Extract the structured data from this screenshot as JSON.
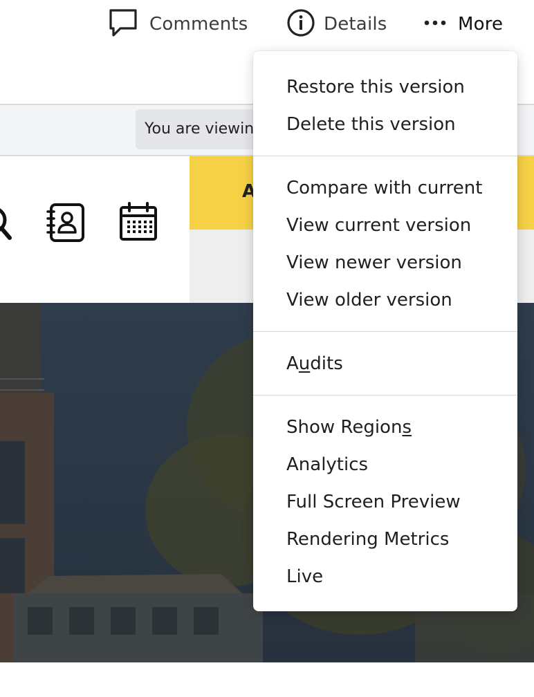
{
  "toolbar": {
    "comments_label": "Comments",
    "details_label": "Details",
    "more_label": "More"
  },
  "version_bar": {
    "notice_text": "You are viewing"
  },
  "preview": {
    "yellow_panel_text": "A",
    "icons": [
      "search-icon",
      "contact-book-icon",
      "calendar-icon"
    ]
  },
  "menu": {
    "groups": [
      {
        "items": [
          {
            "label": "Restore this version"
          },
          {
            "label": "Delete this version"
          }
        ]
      },
      {
        "items": [
          {
            "label": "Compare with current"
          },
          {
            "label": "View current version"
          },
          {
            "label": "View newer version"
          },
          {
            "label": "View older version"
          }
        ]
      },
      {
        "items": [
          {
            "label_pre": "A",
            "label_ul": "u",
            "label_post": "dits"
          }
        ]
      },
      {
        "items": [
          {
            "label_pre": "Show Region",
            "label_ul": "s"
          },
          {
            "label": "Analytics"
          },
          {
            "label": "Full Screen Preview"
          },
          {
            "label": "Rendering Metrics"
          },
          {
            "label": "Live"
          }
        ]
      }
    ]
  },
  "colors": {
    "accent_yellow": "#f6d145",
    "hero_dark": "#2d3a48"
  }
}
